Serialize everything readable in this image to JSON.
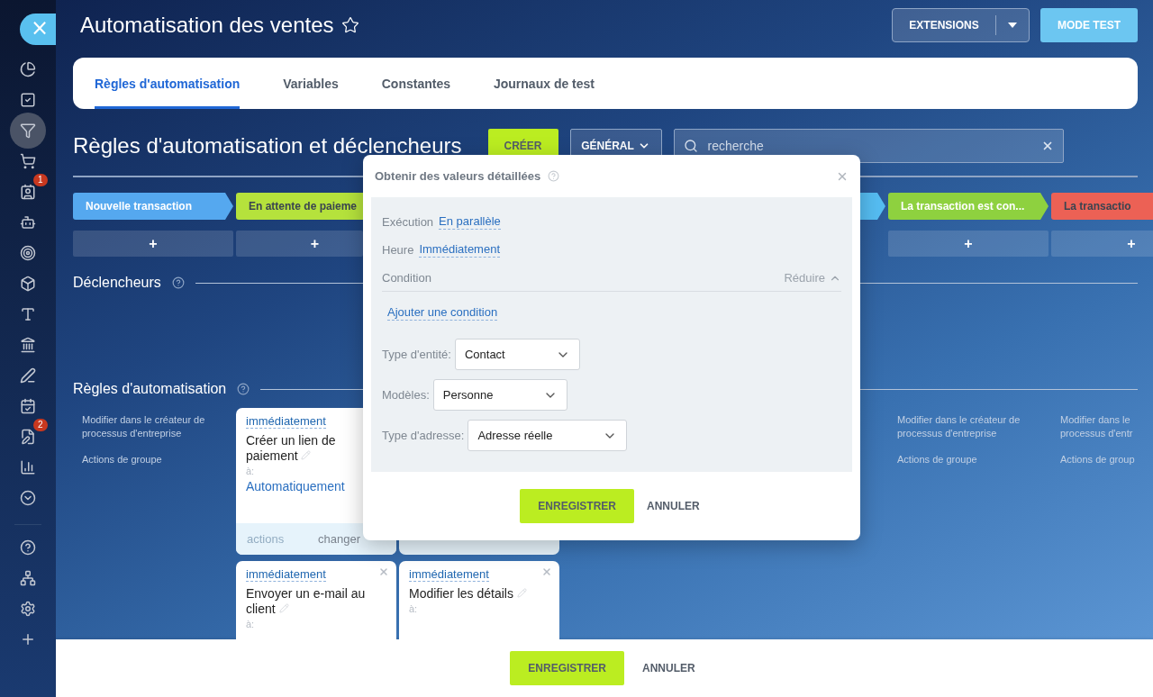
{
  "sidebar": {
    "close": "×",
    "items": [
      {
        "selected": false
      },
      {
        "selected": false
      },
      {
        "selected": true
      },
      {
        "selected": false
      },
      {
        "selected": false,
        "badge": "1"
      },
      {
        "selected": false
      },
      {
        "selected": false
      },
      {
        "selected": false
      },
      {
        "selected": false
      },
      {
        "selected": false
      },
      {
        "selected": false
      },
      {
        "selected": false
      },
      {
        "selected": false,
        "badge": "2"
      },
      {
        "selected": false
      },
      {
        "selected": false
      }
    ],
    "bottom_items": [
      {
        "selected": false
      },
      {
        "selected": false
      },
      {
        "selected": false
      },
      {
        "selected": false
      }
    ]
  },
  "header": {
    "title": "Automatisation des ventes",
    "buttons": [
      {
        "label": "EXTENSIONS",
        "kind": "split"
      },
      {
        "label": "MODE TEST",
        "kind": "primary"
      }
    ]
  },
  "tabs": [
    {
      "label": "Règles d'automatisation",
      "selected": true
    },
    {
      "label": "Variables",
      "selected": false
    },
    {
      "label": "Constantes",
      "selected": false
    },
    {
      "label": "Journaux de test",
      "selected": false
    }
  ],
  "section": {
    "title": "Règles d'automatisation et déclencheurs",
    "create": "CRÉER",
    "filter": "GÉNÉRAL",
    "search": {
      "placeholder": "recherche"
    }
  },
  "stages": [
    {
      "kind": "stage",
      "label": "Nouvelle transaction",
      "color": "#55a8ef",
      "add": "+"
    },
    {
      "kind": "stage",
      "label": "En attente de paieme",
      "color": "#b5e23c",
      "add": "+"
    },
    {
      "kind": "covered"
    },
    {
      "kind": "covered"
    },
    {
      "kind": "stage",
      "color": "#55bdf2"
    },
    {
      "kind": "stage",
      "label": "La transaction est con...",
      "color": "#8ed13f",
      "add": "+"
    },
    {
      "kind": "stage",
      "label": "La transactio",
      "color": "#ec6155",
      "add": "+"
    }
  ],
  "triggers": {
    "title": "Déclencheurs"
  },
  "rules": {
    "title": "Règles d'automatisation",
    "columns": [
      {
        "kind": "links",
        "links": [
          "Modifier dans le créateur de processus d'entreprise",
          "Actions de groupe"
        ]
      },
      {
        "kind": "cards",
        "cards": [
          {
            "kind": "rule",
            "delay": "immédiatement",
            "name": "Créer un lien de paiement",
            "to_label": "à:",
            "to": "Automatiquement",
            "footer": [
              "actions",
              "changer"
            ]
          },
          {
            "kind": "rule",
            "delay": "immédiatement",
            "name": "Envoyer un e-mail au client",
            "to_label": "à:",
            "closable": true
          }
        ]
      },
      {
        "kind": "cards",
        "cards": [
          {
            "kind": "covered"
          },
          {
            "kind": "rule",
            "delay": "immédiatement",
            "name": "Modifier les détails",
            "to_label": "à:",
            "closable": true
          }
        ]
      },
      {
        "kind": "covered"
      },
      {
        "kind": "covered"
      },
      {
        "kind": "links",
        "links": [
          "Modifier dans le créateur de processus d'entreprise",
          "Actions de groupe"
        ]
      },
      {
        "kind": "links",
        "links": [
          "Modifier dans le\nprocessus d'entr",
          "Actions de group"
        ]
      }
    ]
  },
  "dialog": {
    "title": "Obtenir des valeurs détaillées",
    "rows": [
      {
        "label": "Exécution",
        "value": "En parallèle"
      },
      {
        "label": "Heure",
        "value": "Immédiatement"
      }
    ],
    "condition": {
      "label": "Condition",
      "toggle": "Réduire",
      "expanded": true,
      "add": "Ajouter une condition"
    },
    "fields": [
      {
        "label": "Type d'entité:",
        "value": "Contact"
      },
      {
        "label": "Modèles:",
        "value": "Personne"
      },
      {
        "label": "Type d'adresse:",
        "value": "Adresse réelle"
      }
    ],
    "buttons": [
      {
        "label": "ENREGISTRER",
        "kind": "primary"
      },
      {
        "label": "ANNULER",
        "kind": "link"
      }
    ]
  },
  "footer": {
    "buttons": [
      {
        "label": "ENREGISTRER",
        "kind": "primary"
      },
      {
        "label": "ANNULER",
        "kind": "link"
      }
    ]
  }
}
